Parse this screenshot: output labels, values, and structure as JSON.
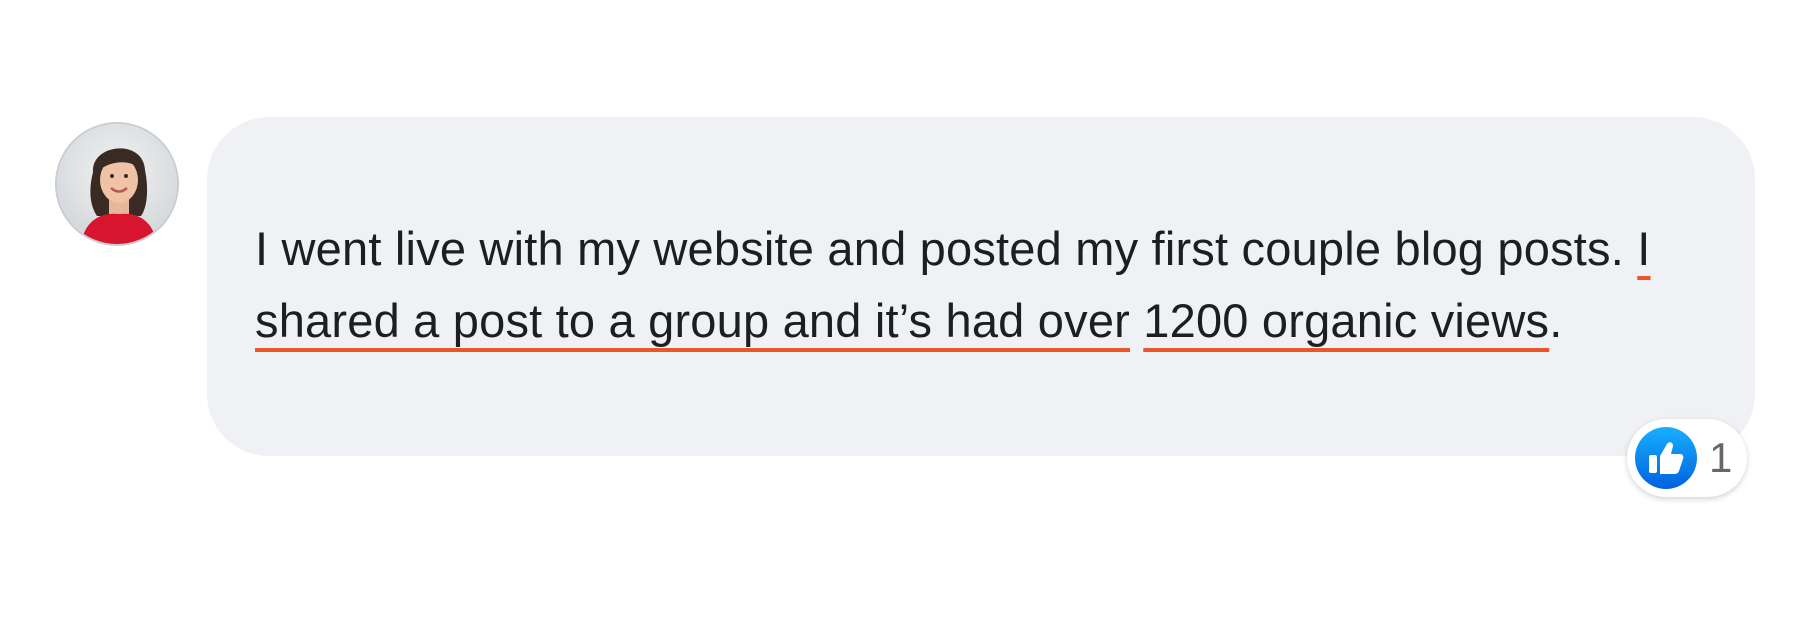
{
  "comment": {
    "text_before": "I went live with my website and posted my first couple blog posts. ",
    "text_highlight_1": "I shared a post to a group and it’s had over",
    "text_highlight_2": "1200 organic views",
    "text_after": "."
  },
  "reactions": {
    "icon": "like-icon",
    "count": "1"
  },
  "colors": {
    "bubble": "#f0f1f5",
    "underline": "#e8562a",
    "like_blue": "#1877f2"
  }
}
